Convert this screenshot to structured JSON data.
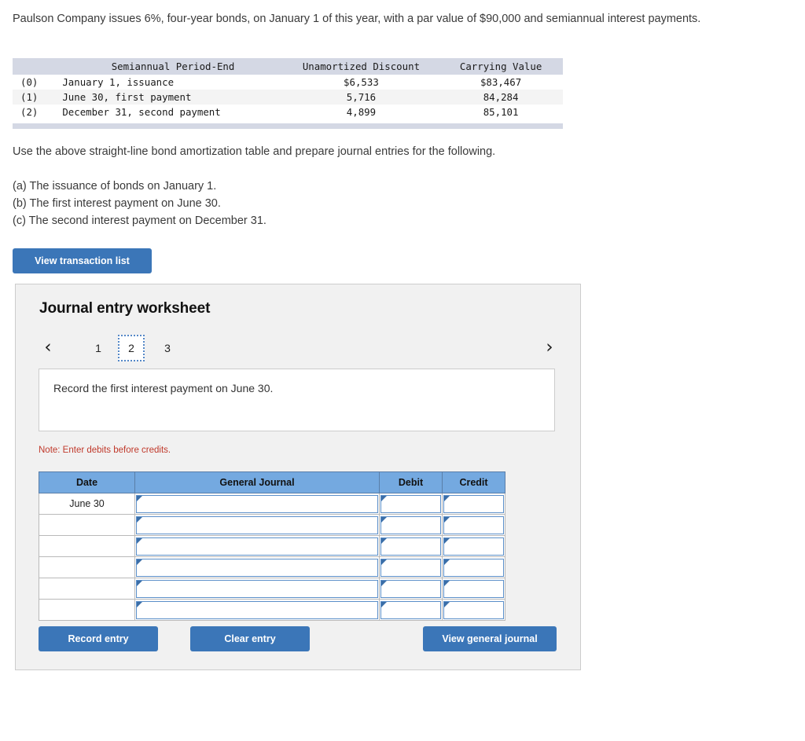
{
  "problem": {
    "statement": "Paulson Company issues 6%, four-year bonds, on January 1 of this year, with a par value of $90,000 and semiannual interest payments."
  },
  "amortization_table": {
    "columns": [
      "",
      "Semiannual Period-End",
      "Unamortized Discount",
      "Carrying Value"
    ],
    "rows": [
      {
        "index": "(0)",
        "period": "January 1, issuance",
        "discount": "$6,533",
        "carrying": "$83,467"
      },
      {
        "index": "(1)",
        "period": "June 30, first payment",
        "discount": "5,716",
        "carrying": "84,284"
      },
      {
        "index": "(2)",
        "period": "December 31, second payment",
        "discount": "4,899",
        "carrying": "85,101"
      }
    ]
  },
  "instructions": {
    "lead": "Use the above straight-line bond amortization table and prepare journal entries for the following.",
    "items": [
      "(a) The issuance of bonds on January 1.",
      "(b) The first interest payment on June 30.",
      "(c) The second interest payment on December 31."
    ]
  },
  "buttons": {
    "view_transaction_list": "View transaction list",
    "record_entry": "Record entry",
    "clear_entry": "Clear entry",
    "view_general_journal": "View general journal"
  },
  "worksheet": {
    "title": "Journal entry worksheet",
    "pager": {
      "prev_icon": "chevron-left-icon",
      "next_icon": "chevron-right-icon",
      "prev_glyph": "‹",
      "next_glyph": "›",
      "pages": [
        "1",
        "2",
        "3"
      ],
      "active_page": "2"
    },
    "description": "Record the first interest payment on June 30.",
    "note": "Note: Enter debits before credits.",
    "journal_table": {
      "headers": [
        "Date",
        "General Journal",
        "Debit",
        "Credit"
      ],
      "rows": [
        {
          "date": "June 30",
          "journal": "",
          "debit": "",
          "credit": ""
        },
        {
          "date": "",
          "journal": "",
          "debit": "",
          "credit": ""
        },
        {
          "date": "",
          "journal": "",
          "debit": "",
          "credit": ""
        },
        {
          "date": "",
          "journal": "",
          "debit": "",
          "credit": ""
        },
        {
          "date": "",
          "journal": "",
          "debit": "",
          "credit": ""
        },
        {
          "date": "",
          "journal": "",
          "debit": "",
          "credit": ""
        }
      ]
    }
  },
  "colors": {
    "primary_button": "#3b76b8",
    "table_header_blue": "#74a9e0",
    "amort_header": "#d4d8e4",
    "note_red": "#c0392b",
    "panel_bg": "#f1f1f1"
  }
}
